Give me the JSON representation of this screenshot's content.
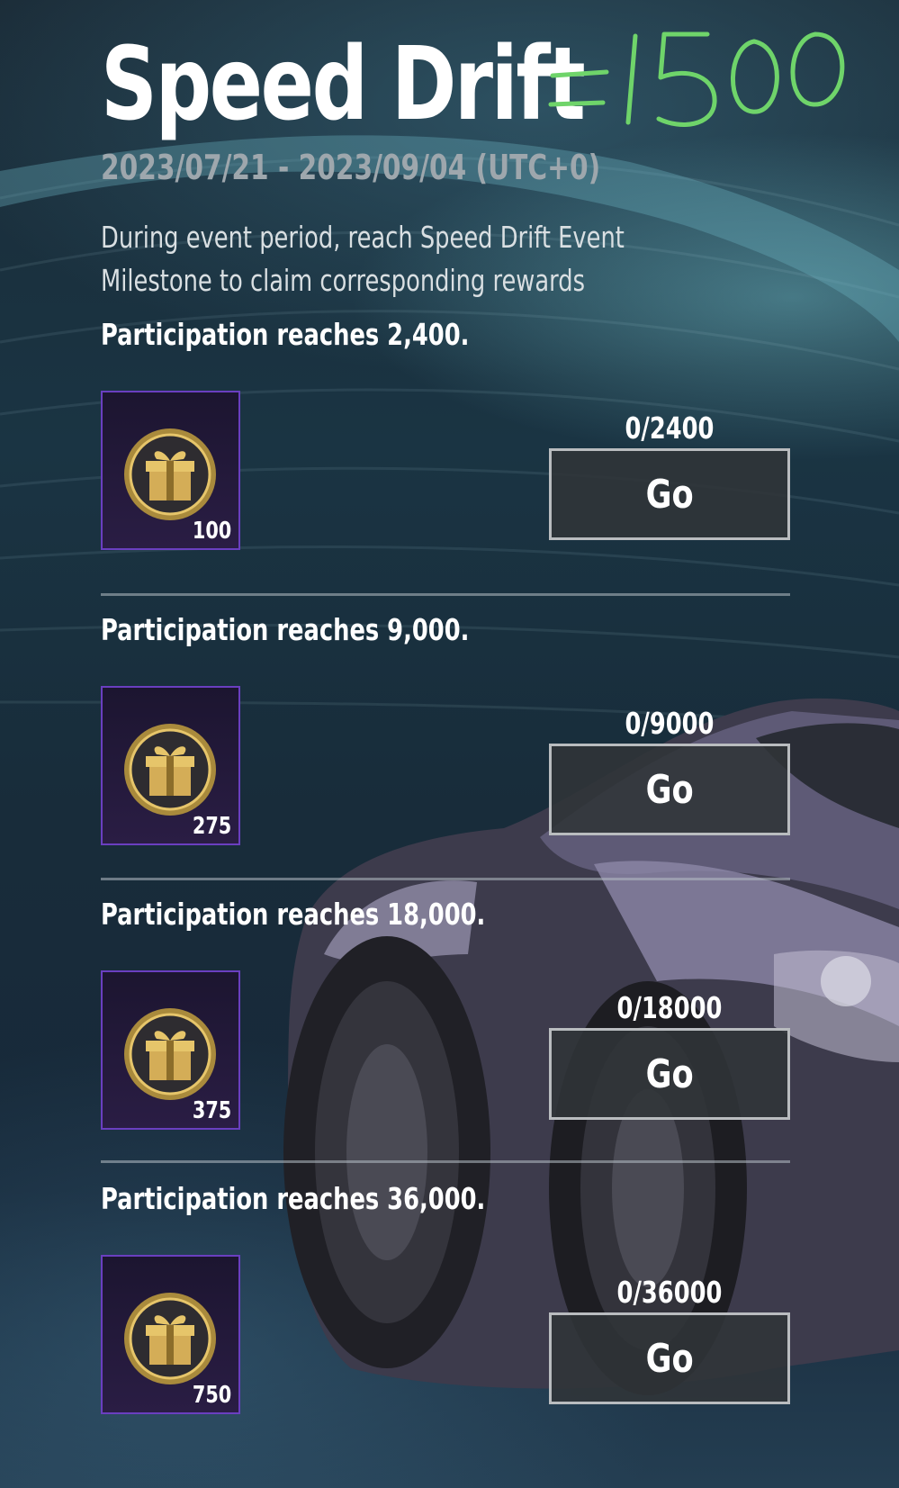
{
  "event": {
    "title": "Speed Drift",
    "annotation": "=1500",
    "dates": "2023/07/21 - 2023/09/04 (UTC+0)",
    "description_line1": "During event period, reach Speed Drift Event",
    "description_line2": "Milestone to claim corresponding rewards"
  },
  "milestones": [
    {
      "label": "Participation reaches 2,400.",
      "reward_icon": "gift-coin-icon",
      "reward_amount": "100",
      "progress": "0/2400",
      "button_label": "Go"
    },
    {
      "label": "Participation reaches 9,000.",
      "reward_icon": "gift-coin-icon",
      "reward_amount": "275",
      "progress": "0/9000",
      "button_label": "Go"
    },
    {
      "label": "Participation reaches 18,000.",
      "reward_icon": "gift-coin-icon",
      "reward_amount": "375",
      "progress": "0/18000",
      "button_label": "Go"
    },
    {
      "label": "Participation reaches 36,000.",
      "reward_icon": "gift-coin-icon",
      "reward_amount": "750",
      "progress": "0/36000",
      "button_label": "Go"
    }
  ],
  "colors": {
    "reward_border": "#6a3fc0",
    "annotation": "#6fd46a",
    "button_border": "#b9bcbf"
  }
}
